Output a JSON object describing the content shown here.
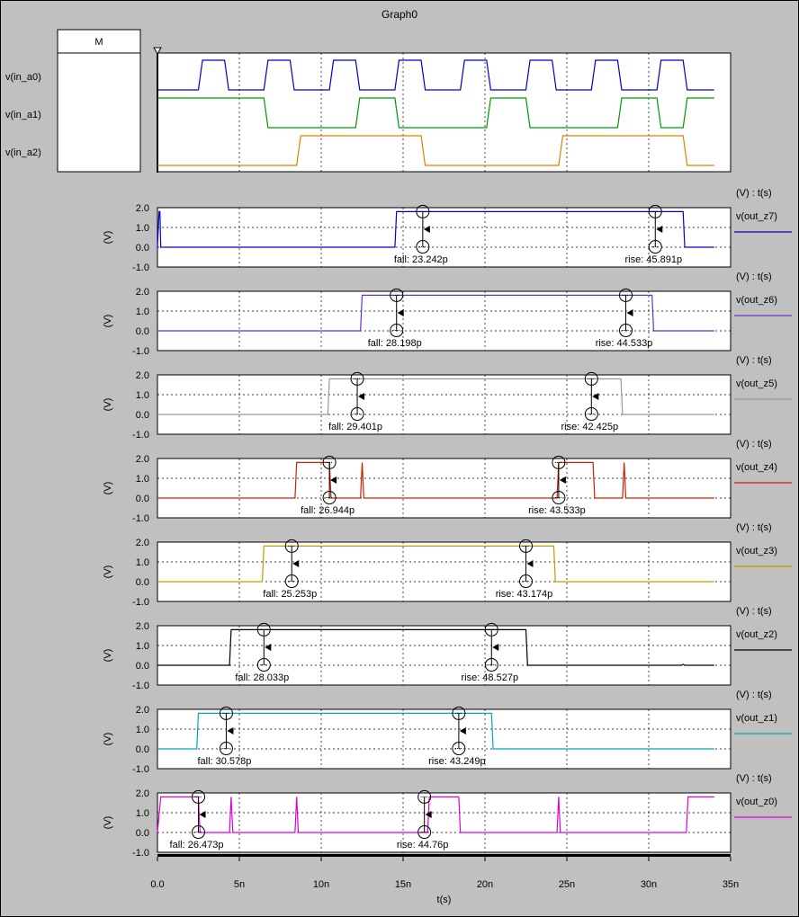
{
  "graph": {
    "title": "Graph0"
  },
  "marker": {
    "label": "M"
  },
  "colors": {
    "in_a0": "#0000cc",
    "in_a1": "#009900",
    "in_a2": "#e08000",
    "out_z7": "#0000cc",
    "out_z6": "#6633cc",
    "out_z5": "#999999",
    "out_z4": "#cc2200",
    "out_z3": "#b8a000",
    "out_z2": "#000000",
    "out_z1": "#00aaaa",
    "out_z0": "#dd00dd"
  },
  "axis": {
    "xlabel": "t(s)",
    "xticks": [
      "0.0",
      "5n",
      "10n",
      "15n",
      "20n",
      "25n",
      "30n",
      "35n"
    ],
    "xlim_ns": [
      0,
      35
    ],
    "yticks": [
      "2.0",
      "1.0",
      "0.0",
      "-1.0"
    ],
    "ylim": [
      -1.0,
      2.0
    ],
    "ylabel": "(V)",
    "units_label": "(V) : t(s)"
  },
  "chart_data": {
    "type": "line",
    "digital_inputs": [
      {
        "name": "v(in_a0)",
        "transitions_ns": [
          2.5,
          4.1,
          6.5,
          8.1,
          10.5,
          12.1,
          14.5,
          16.1,
          18.5,
          20.1,
          22.5,
          24.1,
          26.5,
          28.1,
          30.5,
          32.1
        ],
        "initial": 0,
        "end_ns": 34
      },
      {
        "name": "v(in_a1)",
        "transitions_ns": [
          6.5,
          12.1,
          14.5,
          20.1,
          22.5,
          28.1,
          30.5,
          32.1
        ],
        "initial": 1,
        "end_ns": 34
      },
      {
        "name": "v(in_a2)",
        "transitions_ns": [
          8.5,
          16.1,
          24.5,
          32.1
        ],
        "initial": 0,
        "end_ns": 34
      }
    ],
    "series": [
      {
        "name": "v(out_z7)",
        "color_key": "out_z7",
        "points": [
          [
            0,
            0
          ],
          [
            0.1,
            1.8
          ],
          [
            0.15,
            1.8
          ],
          [
            0.2,
            0
          ],
          [
            14.5,
            0
          ],
          [
            14.6,
            1.8
          ],
          [
            32.1,
            1.8
          ],
          [
            32.2,
            0
          ],
          [
            34,
            0
          ]
        ],
        "fall_label": "fall: 23.242p",
        "rise_label": "rise: 45.891p",
        "cursors_ns": [
          16.2,
          30.4
        ]
      },
      {
        "name": "v(out_z6)",
        "color_key": "out_z6",
        "points": [
          [
            0,
            0
          ],
          [
            12.4,
            0
          ],
          [
            12.5,
            1.8
          ],
          [
            30.2,
            1.8
          ],
          [
            30.3,
            0
          ],
          [
            34,
            0
          ]
        ],
        "fall_label": "fall: 28.198p",
        "rise_label": "rise: 44.533p",
        "cursors_ns": [
          14.6,
          28.6
        ]
      },
      {
        "name": "v(out_z5)",
        "color_key": "out_z5",
        "points": [
          [
            0,
            0
          ],
          [
            10.4,
            0
          ],
          [
            10.5,
            1.8
          ],
          [
            28.3,
            1.8
          ],
          [
            28.4,
            0
          ],
          [
            34,
            0
          ]
        ],
        "fall_label": "fall: 29.401p",
        "rise_label": "rise: 42.425p",
        "cursors_ns": [
          12.2,
          26.5
        ]
      },
      {
        "name": "v(out_z4)",
        "color_key": "out_z4",
        "points": [
          [
            0,
            0
          ],
          [
            8.4,
            0
          ],
          [
            8.5,
            1.8
          ],
          [
            10.5,
            1.8
          ],
          [
            10.6,
            0
          ],
          [
            12.4,
            0
          ],
          [
            12.5,
            1.8
          ],
          [
            12.6,
            0
          ],
          [
            24.4,
            0
          ],
          [
            24.5,
            1.8
          ],
          [
            26.6,
            1.8
          ],
          [
            26.7,
            0
          ],
          [
            28.4,
            0
          ],
          [
            28.5,
            1.8
          ],
          [
            28.6,
            0
          ],
          [
            34,
            0
          ]
        ],
        "fall_label": "fall: 26.944p",
        "rise_label": "rise: 43.533p",
        "cursors_ns": [
          10.5,
          24.5
        ]
      },
      {
        "name": "v(out_z3)",
        "color_key": "out_z3",
        "points": [
          [
            0,
            0
          ],
          [
            6.4,
            0
          ],
          [
            6.5,
            1.8
          ],
          [
            24.2,
            1.8
          ],
          [
            24.3,
            0
          ],
          [
            34,
            0
          ]
        ],
        "fall_label": "fall: 25.253p",
        "rise_label": "rise: 43.174p",
        "cursors_ns": [
          8.2,
          22.5
        ]
      },
      {
        "name": "v(out_z2)",
        "color_key": "out_z2",
        "points": [
          [
            0,
            0
          ],
          [
            4.4,
            0
          ],
          [
            4.5,
            1.8
          ],
          [
            22.5,
            1.8
          ],
          [
            22.6,
            0
          ],
          [
            32,
            0
          ],
          [
            32.1,
            0.05
          ],
          [
            32.2,
            0
          ],
          [
            34,
            0
          ]
        ],
        "fall_label": "fall: 28.033p",
        "rise_label": "rise: 48.527p",
        "cursors_ns": [
          6.5,
          20.4
        ]
      },
      {
        "name": "v(out_z1)",
        "color_key": "out_z1",
        "points": [
          [
            0,
            0
          ],
          [
            2.4,
            0
          ],
          [
            2.5,
            1.8
          ],
          [
            20.4,
            1.8
          ],
          [
            20.5,
            0
          ],
          [
            34,
            0
          ]
        ],
        "fall_label": "fall: 30.578p",
        "rise_label": "rise: 43.249p",
        "cursors_ns": [
          4.2,
          18.4
        ]
      },
      {
        "name": "v(out_z0)",
        "color_key": "out_z0",
        "points": [
          [
            0,
            0
          ],
          [
            0.2,
            1.8
          ],
          [
            2.5,
            1.8
          ],
          [
            2.6,
            0
          ],
          [
            4.4,
            0
          ],
          [
            4.5,
            1.8
          ],
          [
            4.6,
            0
          ],
          [
            8.4,
            0
          ],
          [
            8.5,
            1.8
          ],
          [
            8.6,
            0
          ],
          [
            16.5,
            0
          ],
          [
            16.6,
            1.8
          ],
          [
            18.4,
            1.8
          ],
          [
            18.5,
            0
          ],
          [
            24.4,
            0
          ],
          [
            24.5,
            1.8
          ],
          [
            24.6,
            0
          ],
          [
            32.3,
            0
          ],
          [
            32.4,
            1.8
          ],
          [
            34,
            1.8
          ]
        ],
        "fall_label": "fall: 26.473p",
        "rise_label": "rise: 44.76p",
        "cursors_ns": [
          2.5,
          16.3
        ]
      }
    ]
  }
}
